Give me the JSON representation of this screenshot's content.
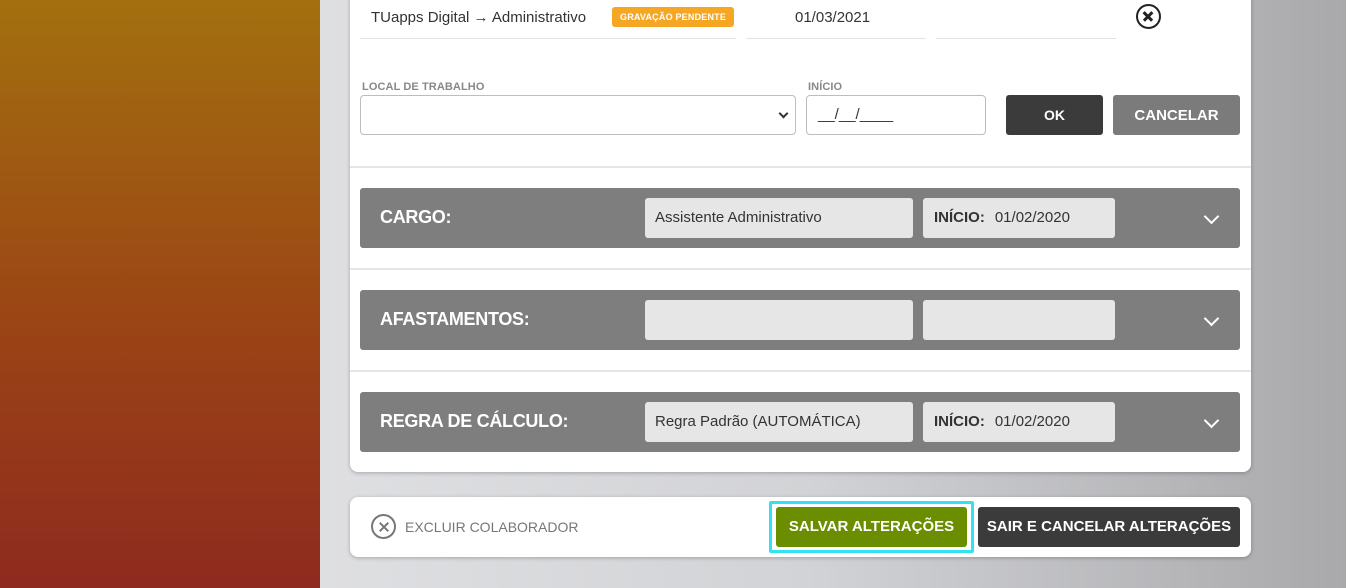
{
  "current_assignment": {
    "path": "TUapps Digital → Administrativo",
    "status_badge": "GRAVAÇÃO PENDENTE",
    "date": "01/03/2021"
  },
  "new_assignment_form": {
    "workplace_label": "LOCAL DE TRABALHO",
    "workplace_value": "",
    "start_label": "INÍCIO",
    "start_placeholder": "__/__/____",
    "ok_label": "OK",
    "cancel_label": "CANCELAR"
  },
  "sections": [
    {
      "title": "CARGO:",
      "value": "Assistente Administrativo",
      "date_label": "INÍCIO:",
      "date": "01/02/2020"
    },
    {
      "title": "AFASTAMENTOS:",
      "value": "",
      "date_label": "",
      "date": ""
    },
    {
      "title": "REGRA DE CÁLCULO:",
      "value": "Regra Padrão (AUTOMÁTICA)",
      "date_label": "INÍCIO:",
      "date": "01/02/2020"
    }
  ],
  "footer": {
    "delete_label": "EXCLUIR COLABORADOR",
    "save_label": "SALVAR ALTERAÇÕES",
    "exit_label": "SAIR E CANCELAR ALTERAÇÕES"
  },
  "colors": {
    "save_button": "#6b8e00",
    "dark_button": "#3b3b3b",
    "section_bar": "#7e7e7e",
    "pending_badge": "#f5a623",
    "focus_ring": "#35e0f0"
  },
  "icons": {
    "remove": "circle-x-icon",
    "delete": "circle-x-icon",
    "select": "chevron-down-icon",
    "expand": "chevron-down-icon"
  }
}
